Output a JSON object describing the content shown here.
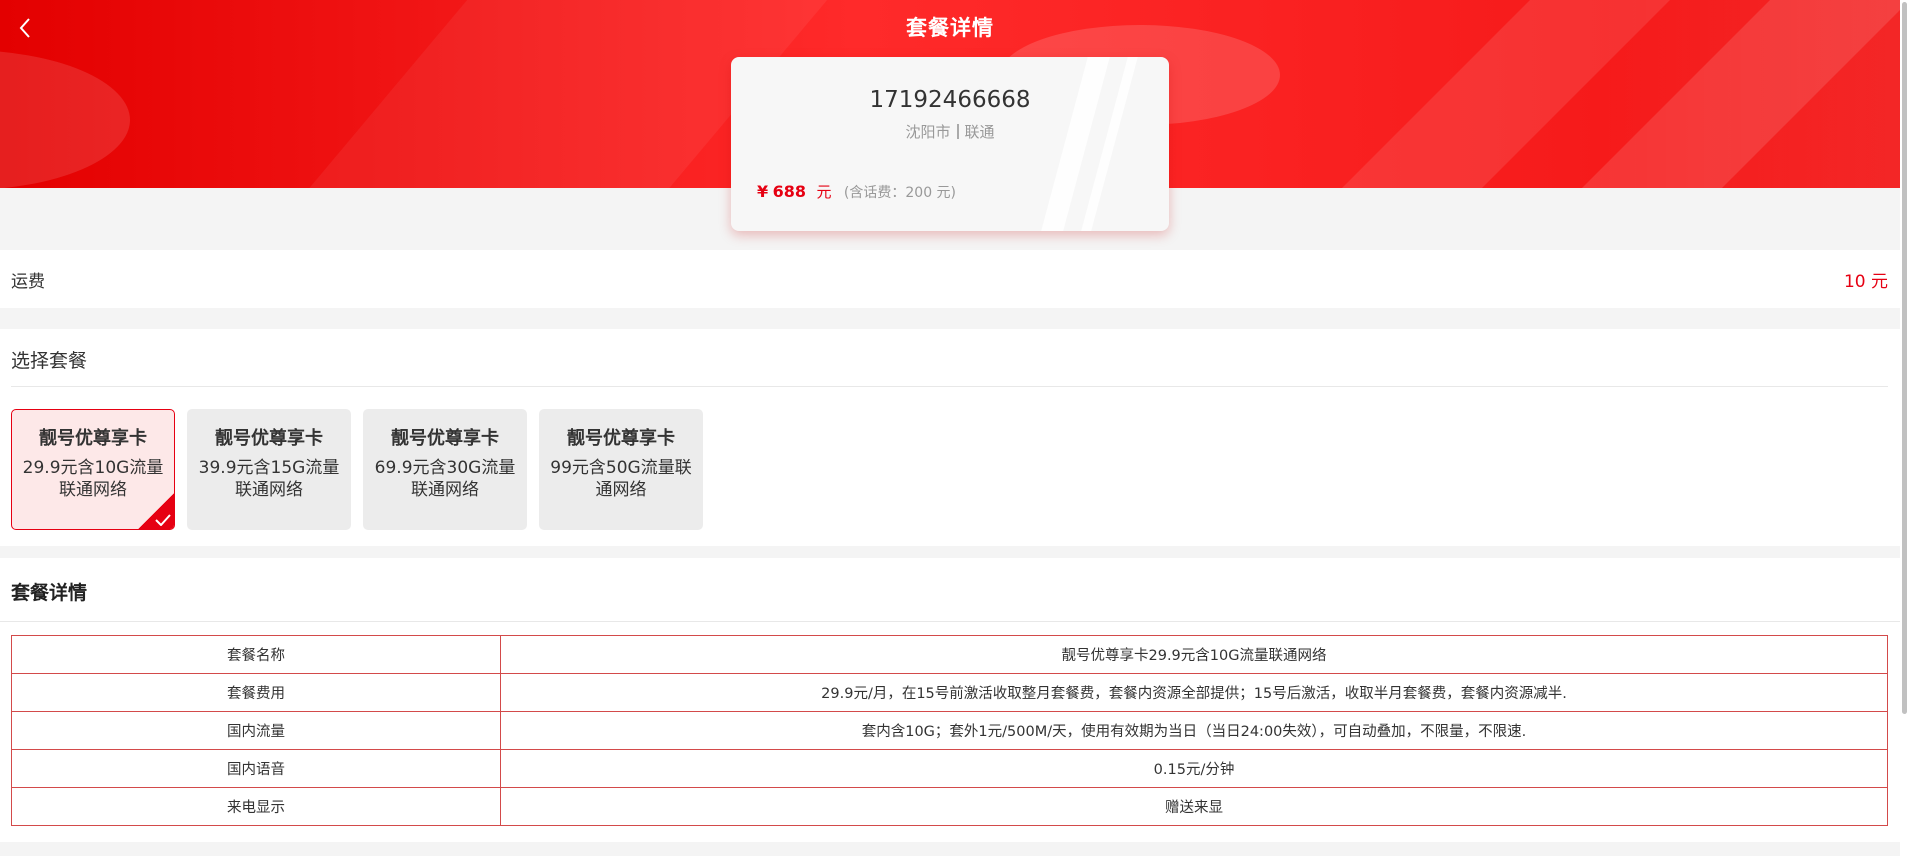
{
  "header": {
    "title": "套餐详情"
  },
  "number_card": {
    "number": "17192466668",
    "city": "沈阳市",
    "carrier": "联通",
    "price_symbol": "¥",
    "price": "688",
    "price_unit": "元",
    "price_note": "(含话费：200 元)"
  },
  "shipping": {
    "label": "运费",
    "value": "10 元"
  },
  "plans": {
    "title": "选择套餐",
    "items": [
      {
        "name": "靓号优尊享卡",
        "desc": "29.9元含10G流量联通网络",
        "selected": true
      },
      {
        "name": "靓号优尊享卡",
        "desc": "39.9元含15G流量联通网络",
        "selected": false
      },
      {
        "name": "靓号优尊享卡",
        "desc": "69.9元含30G流量联通网络",
        "selected": false
      },
      {
        "name": "靓号优尊享卡",
        "desc": "99元含50G流量联通网络",
        "selected": false
      }
    ]
  },
  "details": {
    "title": "套餐详情",
    "rows": [
      {
        "key": "套餐名称",
        "value": "靓号优尊享卡29.9元含10G流量联通网络"
      },
      {
        "key": "套餐费用",
        "value": "29.9元/月，在15号前激活收取整月套餐费，套餐内资源全部提供；15号后激活，收取半月套餐费，套餐内资源减半."
      },
      {
        "key": "国内流量",
        "value": "套内含10G；套外1元/500M/天，使用有效期为当日（当日24:00失效），可自动叠加，不限量，不限速."
      },
      {
        "key": "国内语音",
        "value": "0.15元/分钟"
      },
      {
        "key": "来电显示",
        "value": "赠送来显"
      }
    ]
  },
  "colors": {
    "accent": "#e60012",
    "header_red": "#f21414"
  },
  "icons": {
    "back": "chevron-left-icon",
    "check": "check-icon"
  }
}
